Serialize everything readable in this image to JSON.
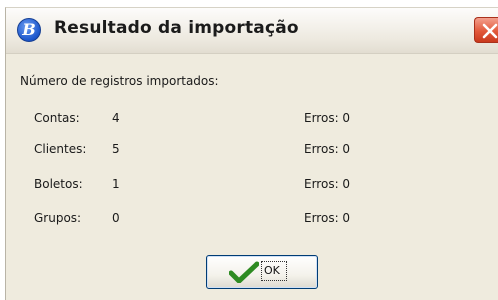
{
  "dialog": {
    "title": "Resultado da importação",
    "icon": "app-logo-icon",
    "close_icon": "close-icon"
  },
  "content": {
    "heading": "Número de registros importados:",
    "rows": [
      {
        "label": "Contas:",
        "value": "4",
        "errors": "Erros: 0"
      },
      {
        "label": "Clientes:",
        "value": "5",
        "errors": "Erros: 0"
      },
      {
        "label": "Boletos:",
        "value": "1",
        "errors": "Erros: 0"
      },
      {
        "label": "Grupos:",
        "value": "0",
        "errors": "Erros: 0"
      }
    ]
  },
  "footer": {
    "ok_label": "OK",
    "ok_icon": "checkmark-icon"
  },
  "colors": {
    "dialog_bg": "#efebde",
    "close_button": "#e2593b",
    "check_green": "#2e8b22"
  }
}
